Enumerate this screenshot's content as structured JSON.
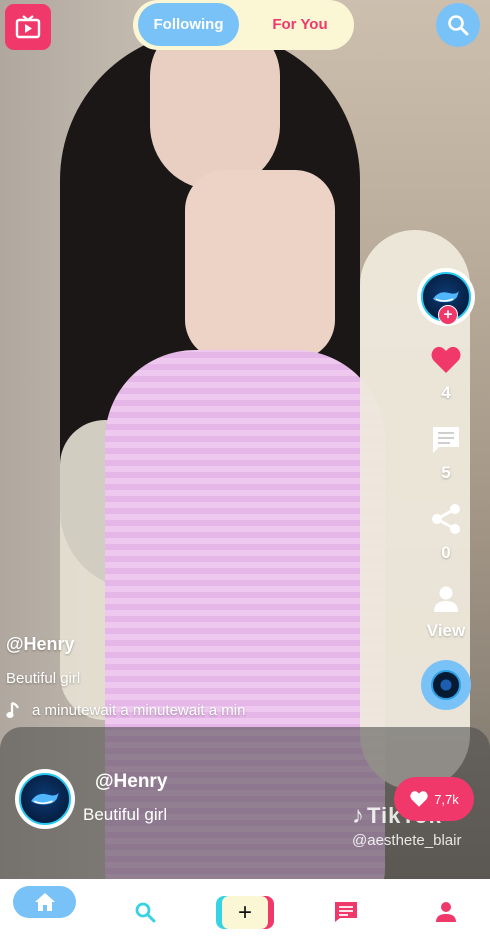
{
  "header": {
    "tabs": [
      {
        "label": "Following",
        "active": true
      },
      {
        "label": "For You",
        "active": false
      }
    ]
  },
  "actions": {
    "like_count": "4",
    "comment_count": "5",
    "share_count": "0",
    "view_label": "View"
  },
  "caption": {
    "username": "@Henry",
    "description": "Beutiful girl",
    "music": "a minutewait a minutewait a min"
  },
  "card": {
    "username": "@Henry",
    "description": "Beutiful girl",
    "likes": "7,7k",
    "watermark_logo": "TikTok",
    "watermark_handle": "@aesthete_blair"
  },
  "colors": {
    "accent_pink": "#f0386b",
    "accent_blue": "#79c2f8",
    "cream": "#fbf7d5",
    "cyan": "#37d2e4"
  },
  "icons": [
    "tv-icon",
    "search-icon",
    "heart-icon",
    "comment-icon",
    "share-icon",
    "user-icon",
    "music-note-icon",
    "home-icon",
    "plus-icon",
    "inbox-icon",
    "profile-icon"
  ]
}
